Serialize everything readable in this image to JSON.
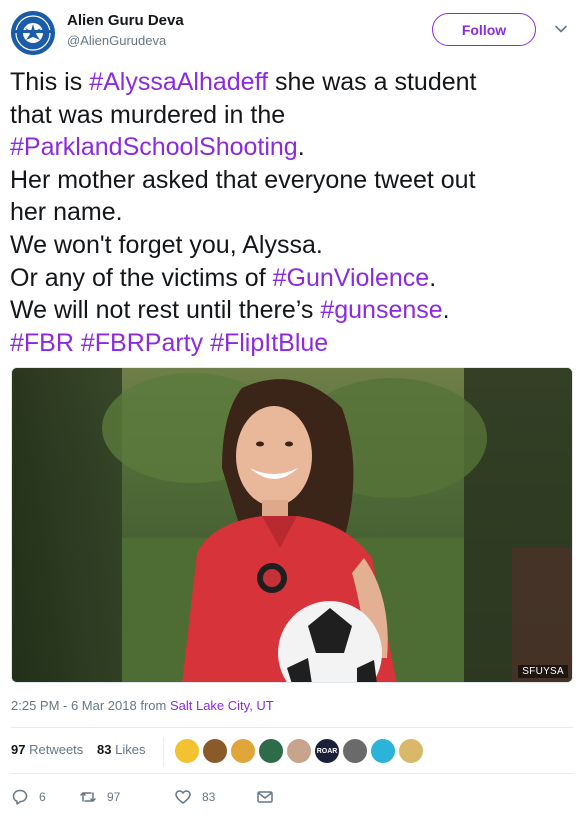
{
  "user": {
    "display_name": "Alien Guru Deva",
    "handle": "@AlienGurudeva",
    "avatar_text_top": "JOIN THE",
    "avatar_text_bottom": "RESISTANCE"
  },
  "follow_label": "Follow",
  "tweet": {
    "segments": [
      [
        {
          "t": "This is "
        },
        {
          "t": "#AlyssaAlhadeff",
          "tag": true
        },
        {
          "t": " she was a student"
        }
      ],
      [
        {
          "t": "that was murdered in the"
        }
      ],
      [
        {
          "t": "#ParklandSchoolShooting",
          "tag": true
        },
        {
          "t": "."
        }
      ],
      [
        {
          "t": "Her mother asked that everyone tweet out"
        }
      ],
      [
        {
          "t": "her name."
        }
      ],
      [
        {
          "t": "We won't forget you, Alyssa."
        }
      ],
      [
        {
          "t": "Or any of the victims of "
        },
        {
          "t": "#GunViolence",
          "tag": true
        },
        {
          "t": "."
        }
      ],
      [
        {
          "t": "We will not rest until there’s "
        },
        {
          "t": "#gunsense",
          "tag": true
        },
        {
          "t": "."
        }
      ],
      [
        {
          "t": "#FBR",
          "tag": true
        },
        {
          "t": " "
        },
        {
          "t": "#FBRParty",
          "tag": true
        },
        {
          "t": " "
        },
        {
          "t": "#FlipItBlue",
          "tag": true
        }
      ]
    ]
  },
  "media": {
    "credit": "SFUYSA"
  },
  "meta": {
    "time": "2:25 PM - 6 Mar 2018 from ",
    "location": "Salt Lake City, UT"
  },
  "stats": {
    "retweets_count": "97",
    "retweets_label": "Retweets",
    "likes_count": "83",
    "likes_label": "Likes",
    "face_badge": "ROAR"
  },
  "actions": {
    "reply_count": "6",
    "retweet_count": "97",
    "like_count": "83"
  },
  "colors": {
    "accent": "#8a2be2",
    "secondary_text": "#657786",
    "primary_text": "#14171a"
  }
}
